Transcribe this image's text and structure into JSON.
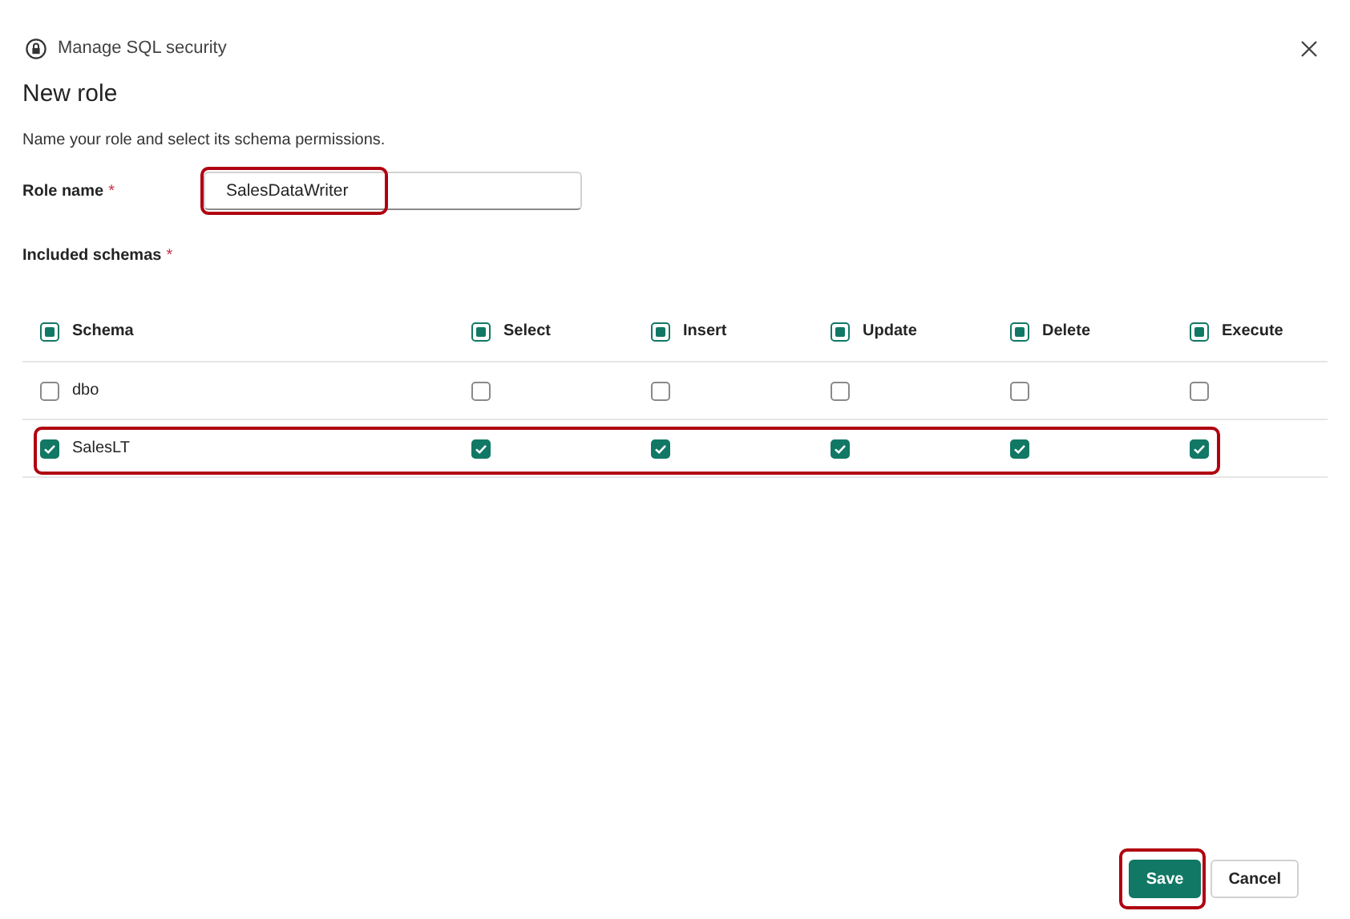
{
  "window": {
    "title": "Manage SQL security"
  },
  "heading": "New role",
  "description": "Name your role and select its schema permissions.",
  "role_name": {
    "label": "Role name",
    "required_mark": "*",
    "value": "SalesDataWriter",
    "highlighted": true
  },
  "schemas": {
    "label": "Included schemas",
    "required_mark": "*",
    "columns": [
      {
        "label": "Schema",
        "indeterminate": true
      },
      {
        "label": "Select",
        "indeterminate": true
      },
      {
        "label": "Insert",
        "indeterminate": true
      },
      {
        "label": "Update",
        "indeterminate": true
      },
      {
        "label": "Delete",
        "indeterminate": true
      },
      {
        "label": "Execute",
        "indeterminate": true
      }
    ],
    "rows": [
      {
        "name": "dbo",
        "highlighted": false,
        "checks": [
          false,
          false,
          false,
          false,
          false,
          false
        ]
      },
      {
        "name": "SalesLT",
        "highlighted": true,
        "checks": [
          true,
          true,
          true,
          true,
          true,
          true
        ]
      }
    ]
  },
  "buttons": [
    {
      "label": "Save",
      "kind": "primary",
      "highlighted": true
    },
    {
      "label": "Cancel",
      "kind": "secondary",
      "highlighted": false
    }
  ]
}
